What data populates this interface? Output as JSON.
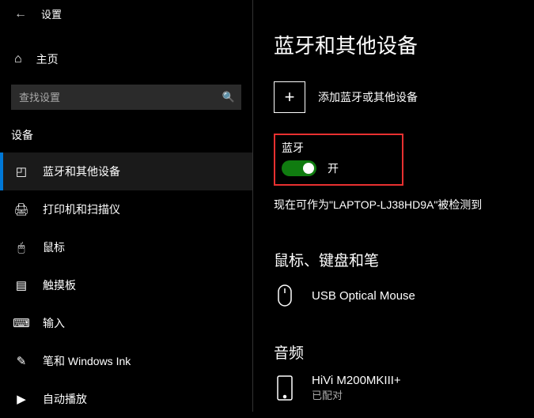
{
  "header": {
    "title": "设置"
  },
  "sidebar": {
    "home": "主页",
    "search_placeholder": "查找设置",
    "section": "设备",
    "items": [
      {
        "label": "蓝牙和其他设备",
        "icon": "bluetooth"
      },
      {
        "label": "打印机和扫描仪",
        "icon": "printer"
      },
      {
        "label": "鼠标",
        "icon": "mouse"
      },
      {
        "label": "触摸板",
        "icon": "touchpad"
      },
      {
        "label": "输入",
        "icon": "keyboard"
      },
      {
        "label": "笔和 Windows Ink",
        "icon": "pen"
      },
      {
        "label": "自动播放",
        "icon": "autoplay"
      }
    ]
  },
  "main": {
    "title": "蓝牙和其他设备",
    "add_label": "添加蓝牙或其他设备",
    "bt_label": "蓝牙",
    "bt_state": "开",
    "discoverable": "现在可作为\"LAPTOP-LJ38HD9A\"被检测到",
    "mouse_kb_title": "鼠标、键盘和笔",
    "mouse_name": "USB Optical Mouse",
    "audio_title": "音频",
    "audio_device": "HiVi M200MKIII+",
    "audio_status": "已配对"
  }
}
